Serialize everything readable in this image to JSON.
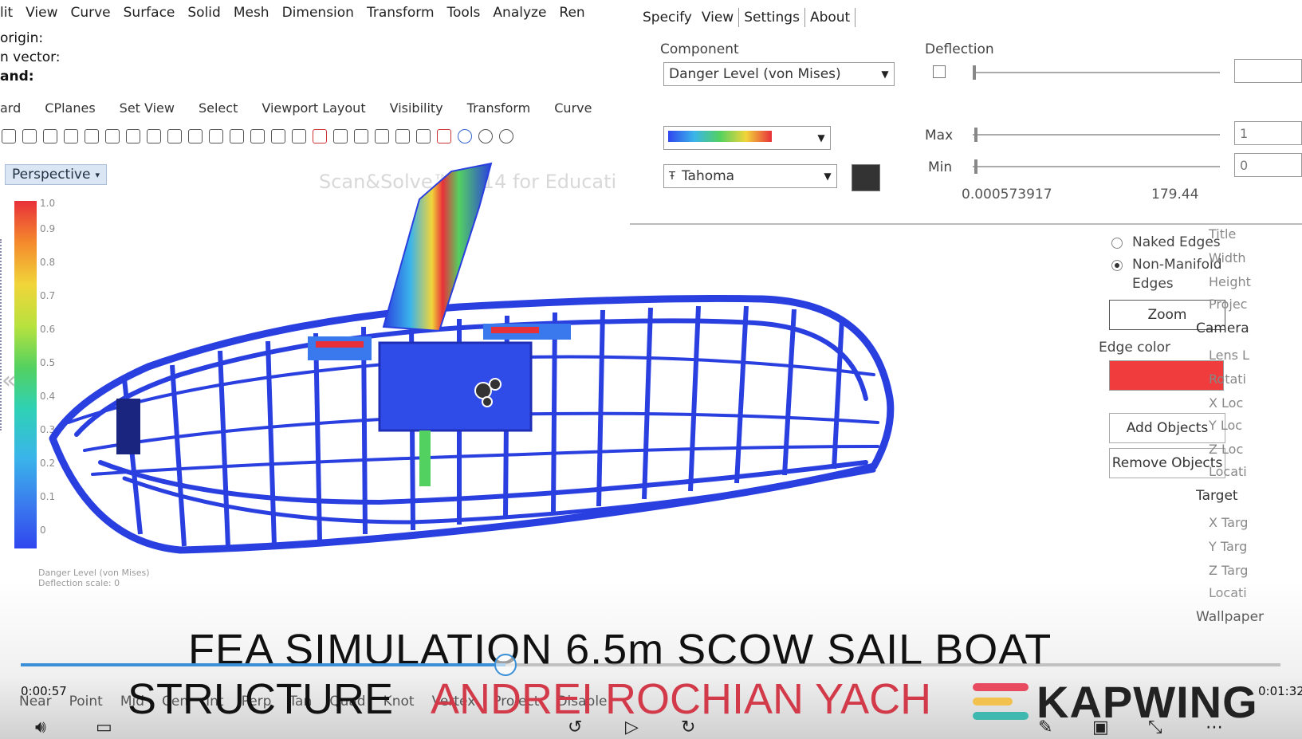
{
  "rhino": {
    "menu": [
      "lit",
      "View",
      "Curve",
      "Surface",
      "Solid",
      "Mesh",
      "Dimension",
      "Transform",
      "Tools",
      "Analyze",
      "Ren"
    ],
    "command_lines": [
      "origin:",
      "n vector:",
      "and:"
    ],
    "toolbar_tabs": [
      "ard",
      "CPlanes",
      "Set View",
      "Select",
      "Viewport Layout",
      "Visibility",
      "Transform",
      "Curve"
    ],
    "viewport_label": "Perspective",
    "watermark": "Scan&Solve™ 2014 for Educati",
    "legend_ticks": [
      "1.0",
      "0.9",
      "0.8",
      "0.7",
      "0.6",
      "0.5",
      "0.4",
      "0.3",
      "0.2",
      "0.1",
      "0"
    ],
    "legend_caption": [
      "Danger Level (von Mises)",
      "Deflection scale: 0"
    ],
    "colors": {
      "legend_top": "#e8303a",
      "legend_bottom": "#2f46ee",
      "model_blue": "#2a3fe0",
      "stress_red": "#e8303a",
      "edge_color": "#f03c3c"
    }
  },
  "scan_solve": {
    "menu": [
      "Specify",
      "View",
      "Settings",
      "About"
    ],
    "component_label": "Component",
    "component_value": "Danger Level (von Mises)",
    "font_value": "Tahoma",
    "deflection_label": "Deflection",
    "max_label": "Max",
    "min_label": "Min",
    "max_value": "1",
    "min_value": "0",
    "range_low": "0.000573917",
    "range_high": "179.44"
  },
  "edge_panel": {
    "naked_edges": "Naked Edges",
    "non_manifold_line1": "Non-Manifold",
    "non_manifold_line2": "Edges",
    "zoom": "Zoom",
    "edge_color_label": "Edge color",
    "add_objects": "Add Objects",
    "remove_objects": "Remove Objects"
  },
  "properties": {
    "items": [
      {
        "text": "Title",
        "header": false
      },
      {
        "text": "Width",
        "header": false
      },
      {
        "text": "Height",
        "header": false
      },
      {
        "text": "Projec",
        "header": false
      },
      {
        "text": "Camera",
        "header": true
      },
      {
        "text": "Lens L",
        "header": false
      },
      {
        "text": "Rotati",
        "header": false
      },
      {
        "text": "X Loc",
        "header": false
      },
      {
        "text": "Y Loc",
        "header": false
      },
      {
        "text": "Z Loc",
        "header": false
      },
      {
        "text": "Locati",
        "header": false
      },
      {
        "text": "Target",
        "header": true
      },
      {
        "text": "X Targ",
        "header": false
      },
      {
        "text": "Y Targ",
        "header": false
      },
      {
        "text": "Z Targ",
        "header": false
      },
      {
        "text": "Locati",
        "header": false
      },
      {
        "text": "Wallpaper",
        "header": true
      }
    ]
  },
  "video": {
    "title_line1": "FEA  SIMULATION 6.5m SCOW SAIL  BOAT",
    "title_line2_dark": "STRUCTURE",
    "title_line2_red": "ANDREI ROCHIAN YACH",
    "current_time": "0:00:57",
    "total_time": "0:01:32",
    "progress": 0.385,
    "watermark_brand": "KAPWING",
    "brand_colors": [
      "#e84a5f",
      "#f2c14e",
      "#3fb8af"
    ]
  },
  "status_bar": [
    "Near",
    "Point",
    "Mid",
    "Cen",
    "Int",
    "Perp",
    "Tan",
    "Quad",
    "Knot",
    "Vertex",
    "Project",
    "Disable"
  ]
}
